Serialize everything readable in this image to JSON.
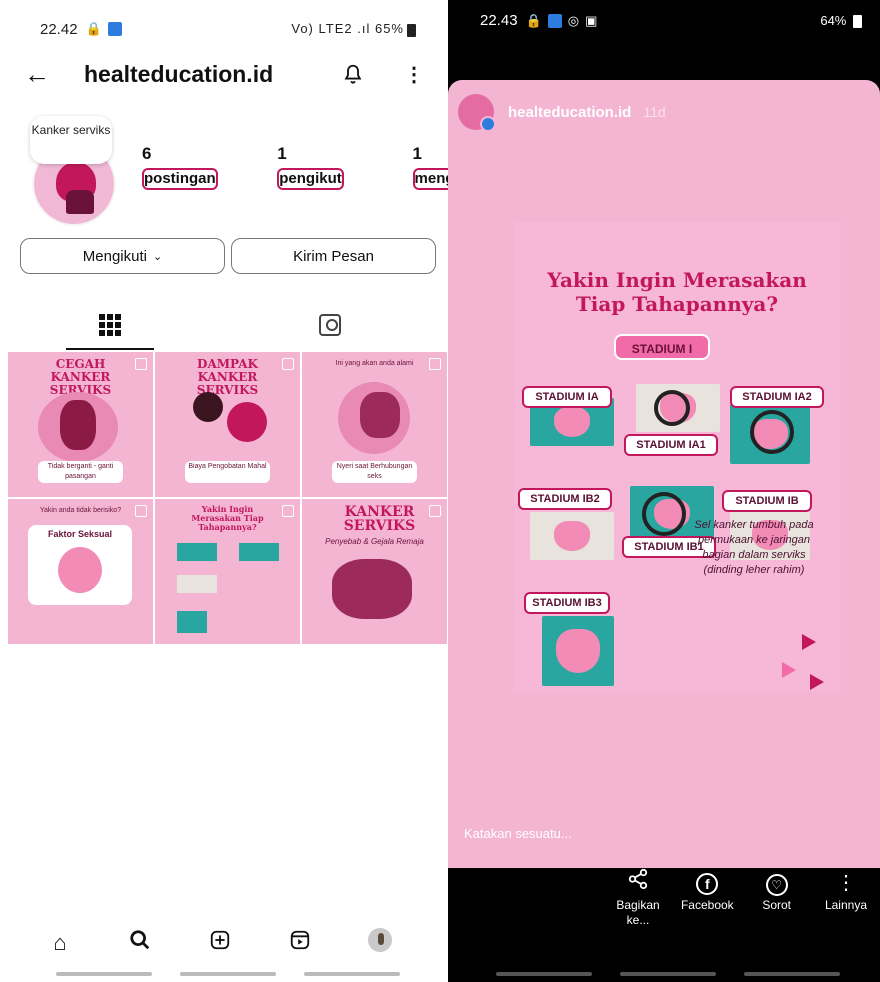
{
  "left": {
    "status": {
      "time": "22.42",
      "battery": "65%",
      "signal": "Vo) LTE2 .ıl"
    },
    "header": {
      "back_icon": "arrow-left-icon",
      "username": "healteducation.id",
      "bell_icon": "bell-icon",
      "more_icon": "more-vertical-icon"
    },
    "profile": {
      "note": "Kanker serviks",
      "stats": [
        {
          "value": "6",
          "label": "postingan"
        },
        {
          "value": "1",
          "label": "pengikut"
        },
        {
          "value": "1",
          "label": "mengikuti"
        }
      ]
    },
    "buttons": {
      "following": "Mengikuti",
      "message": "Kirim Pesan"
    },
    "tabs": {
      "grid_icon": "grid-icon",
      "tagged_icon": "tagged-person-icon"
    },
    "posts": [
      {
        "title": "CEGAH KANKER SERVIKS",
        "caption": "Tidak berganti - ganti pasangan"
      },
      {
        "title": "DAMPAK KANKER SERVIKS",
        "caption": "Biaya Pengobatan Mahal"
      },
      {
        "title": "",
        "top": "Ini yang akan anda alami",
        "caption": "Nyeri saat Berhubungan seks"
      },
      {
        "title": "",
        "top": "Yakin anda tidak berisiko?",
        "caption": "Faktor Seksual"
      },
      {
        "title": "Yakin Ingin Merasakan Tiap Tahapannya?",
        "caption": ""
      },
      {
        "title": "KANKER SERVIKS",
        "caption": "Penyebab & Gejala Remaja"
      }
    ],
    "nav": [
      "home-icon",
      "search-icon",
      "add-post-icon",
      "reels-icon",
      "profile-avatar-icon"
    ]
  },
  "right": {
    "status": {
      "time": "22.43",
      "battery": "64%"
    },
    "story": {
      "username": "healteducation.id",
      "age": "11d",
      "headline_1": "Yakin Ingin Merasakan",
      "headline_2": "Tiap Tahapannya?",
      "stage_main": "STADIUM I",
      "stages": [
        "STADIUM IA",
        "STADIUM IA2",
        "STADIUM IA1",
        "STADIUM IB2",
        "STADIUM IB",
        "STADIUM IB1",
        "STADIUM IB3"
      ],
      "description": "Sel kanker tumbuh pada permukaan ke jaringan bagian dalam serviks (dinding leher rahim)"
    },
    "reply_placeholder": "Katakan sesuatu...",
    "actions": [
      {
        "icon": "share-icon",
        "label": "Bagikan ke..."
      },
      {
        "icon": "facebook-icon",
        "label": "Facebook"
      },
      {
        "icon": "highlight-icon",
        "label": "Sorot"
      },
      {
        "icon": "more-vertical-icon",
        "label": "Lainnya"
      }
    ]
  }
}
